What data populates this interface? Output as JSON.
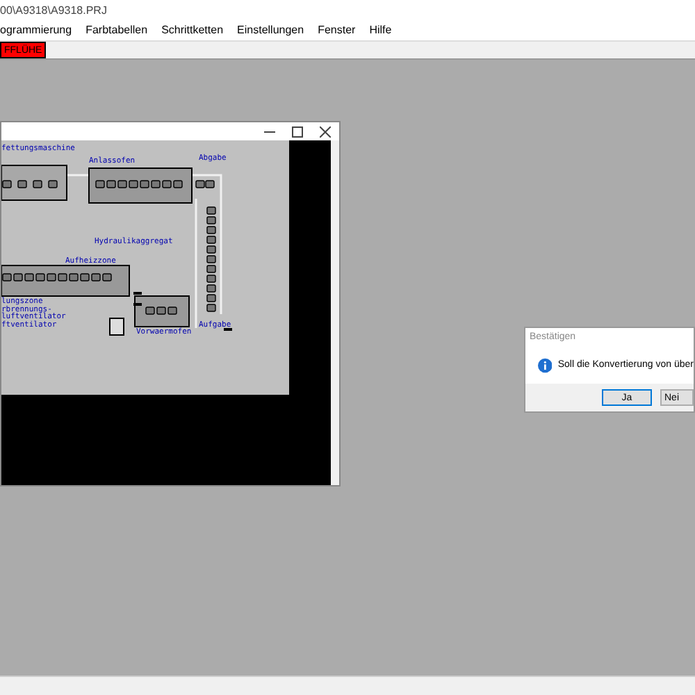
{
  "window": {
    "title": "00\\A9318\\A9318.PRJ"
  },
  "menu": [
    "ogrammierung",
    "Farbtabellen",
    "Schrittketten",
    "Einstellungen",
    "Fenster",
    "Hilfe"
  ],
  "toolbar": {
    "alarm_button": "FFLÜHE"
  },
  "child_window": {
    "diagram_labels": [
      "fettungsmaschine",
      "Anlassofen",
      "Abgabe",
      "Hydraulikaggregat",
      "Aufheizzone",
      "lungszone",
      "rbrennungs-",
      "luftventilator",
      "ftventilator",
      "Vorwaermofen",
      "Aufgabe"
    ]
  },
  "dialog": {
    "title": "Bestätigen",
    "message": "Soll die Konvertierung von  über",
    "buttons": [
      {
        "label": "Ja",
        "selected": true
      },
      {
        "label": "Nei",
        "selected": false
      }
    ]
  }
}
